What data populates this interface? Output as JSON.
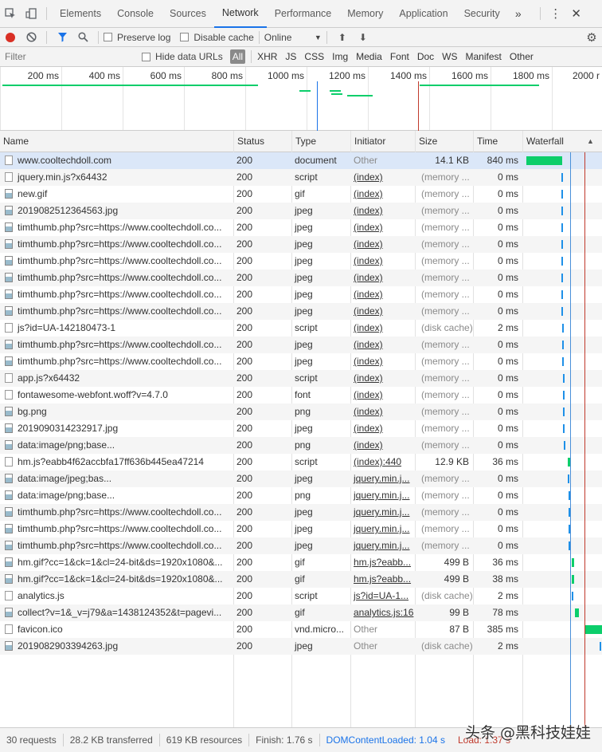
{
  "tabs": [
    "Elements",
    "Console",
    "Sources",
    "Network",
    "Performance",
    "Memory",
    "Application",
    "Security"
  ],
  "toolbar": {
    "preserve_log": "Preserve log",
    "disable_cache": "Disable cache",
    "throttle": "Online"
  },
  "filter": {
    "placeholder": "Filter",
    "hide_data_urls": "Hide data URLs",
    "types": [
      "All",
      "XHR",
      "JS",
      "CSS",
      "Img",
      "Media",
      "Font",
      "Doc",
      "WS",
      "Manifest",
      "Other"
    ]
  },
  "overview": {
    "ticks": [
      "200 ms",
      "400 ms",
      "600 ms",
      "800 ms",
      "1000 ms",
      "1200 ms",
      "1400 ms",
      "1600 ms",
      "1800 ms",
      "2000 r"
    ]
  },
  "columns": [
    "Name",
    "Status",
    "Type",
    "Initiator",
    "Size",
    "Time",
    "Waterfall"
  ],
  "rows": [
    {
      "name": "www.cooltechdoll.com",
      "status": "200",
      "type": "document",
      "initiator": "Other",
      "size": "14.1 KB",
      "time": "840 ms"
    },
    {
      "name": "jquery.min.js?x64432",
      "status": "200",
      "type": "script",
      "initiator": "(index)",
      "size": "(memory ...",
      "time": "0 ms"
    },
    {
      "name": "new.gif",
      "status": "200",
      "type": "gif",
      "initiator": "(index)",
      "size": "(memory ...",
      "time": "0 ms"
    },
    {
      "name": "2019082512364563.jpg",
      "status": "200",
      "type": "jpeg",
      "initiator": "(index)",
      "size": "(memory ...",
      "time": "0 ms"
    },
    {
      "name": "timthumb.php?src=https://www.cooltechdoll.co...",
      "status": "200",
      "type": "jpeg",
      "initiator": "(index)",
      "size": "(memory ...",
      "time": "0 ms"
    },
    {
      "name": "timthumb.php?src=https://www.cooltechdoll.co...",
      "status": "200",
      "type": "jpeg",
      "initiator": "(index)",
      "size": "(memory ...",
      "time": "0 ms"
    },
    {
      "name": "timthumb.php?src=https://www.cooltechdoll.co...",
      "status": "200",
      "type": "jpeg",
      "initiator": "(index)",
      "size": "(memory ...",
      "time": "0 ms"
    },
    {
      "name": "timthumb.php?src=https://www.cooltechdoll.co...",
      "status": "200",
      "type": "jpeg",
      "initiator": "(index)",
      "size": "(memory ...",
      "time": "0 ms"
    },
    {
      "name": "timthumb.php?src=https://www.cooltechdoll.co...",
      "status": "200",
      "type": "jpeg",
      "initiator": "(index)",
      "size": "(memory ...",
      "time": "0 ms"
    },
    {
      "name": "timthumb.php?src=https://www.cooltechdoll.co...",
      "status": "200",
      "type": "jpeg",
      "initiator": "(index)",
      "size": "(memory ...",
      "time": "0 ms"
    },
    {
      "name": "js?id=UA-142180473-1",
      "status": "200",
      "type": "script",
      "initiator": "(index)",
      "size": "(disk cache)",
      "time": "2 ms"
    },
    {
      "name": "timthumb.php?src=https://www.cooltechdoll.co...",
      "status": "200",
      "type": "jpeg",
      "initiator": "(index)",
      "size": "(memory ...",
      "time": "0 ms"
    },
    {
      "name": "timthumb.php?src=https://www.cooltechdoll.co...",
      "status": "200",
      "type": "jpeg",
      "initiator": "(index)",
      "size": "(memory ...",
      "time": "0 ms"
    },
    {
      "name": "app.js?x64432",
      "status": "200",
      "type": "script",
      "initiator": "(index)",
      "size": "(memory ...",
      "time": "0 ms"
    },
    {
      "name": "fontawesome-webfont.woff?v=4.7.0",
      "status": "200",
      "type": "font",
      "initiator": "(index)",
      "size": "(memory ...",
      "time": "0 ms"
    },
    {
      "name": "bg.png",
      "status": "200",
      "type": "png",
      "initiator": "(index)",
      "size": "(memory ...",
      "time": "0 ms"
    },
    {
      "name": "2019090314232917.jpg",
      "status": "200",
      "type": "jpeg",
      "initiator": "(index)",
      "size": "(memory ...",
      "time": "0 ms"
    },
    {
      "name": "data:image/png;base...",
      "status": "200",
      "type": "png",
      "initiator": "(index)",
      "size": "(memory ...",
      "time": "0 ms"
    },
    {
      "name": "hm.js?eabb4f62accbfa17ff636b445ea47214",
      "status": "200",
      "type": "script",
      "initiator": "(index):440",
      "size": "12.9 KB",
      "time": "36 ms"
    },
    {
      "name": "data:image/jpeg;bas...",
      "status": "200",
      "type": "jpeg",
      "initiator": "jquery.min.j...",
      "size": "(memory ...",
      "time": "0 ms"
    },
    {
      "name": "data:image/png;base...",
      "status": "200",
      "type": "png",
      "initiator": "jquery.min.j...",
      "size": "(memory ...",
      "time": "0 ms"
    },
    {
      "name": "timthumb.php?src=https://www.cooltechdoll.co...",
      "status": "200",
      "type": "jpeg",
      "initiator": "jquery.min.j...",
      "size": "(memory ...",
      "time": "0 ms"
    },
    {
      "name": "timthumb.php?src=https://www.cooltechdoll.co...",
      "status": "200",
      "type": "jpeg",
      "initiator": "jquery.min.j...",
      "size": "(memory ...",
      "time": "0 ms"
    },
    {
      "name": "timthumb.php?src=https://www.cooltechdoll.co...",
      "status": "200",
      "type": "jpeg",
      "initiator": "jquery.min.j...",
      "size": "(memory ...",
      "time": "0 ms"
    },
    {
      "name": "hm.gif?cc=1&ck=1&cl=24-bit&ds=1920x1080&...",
      "status": "200",
      "type": "gif",
      "initiator": "hm.js?eabb...",
      "size": "499 B",
      "time": "36 ms"
    },
    {
      "name": "hm.gif?cc=1&ck=1&cl=24-bit&ds=1920x1080&...",
      "status": "200",
      "type": "gif",
      "initiator": "hm.js?eabb...",
      "size": "499 B",
      "time": "38 ms"
    },
    {
      "name": "analytics.js",
      "status": "200",
      "type": "script",
      "initiator": "js?id=UA-1...",
      "size": "(disk cache)",
      "time": "2 ms"
    },
    {
      "name": "collect?v=1&_v=j79&a=1438124352&t=pagevi...",
      "status": "200",
      "type": "gif",
      "initiator": "analytics.js:16",
      "size": "99 B",
      "time": "78 ms"
    },
    {
      "name": "favicon.ico",
      "status": "200",
      "type": "vnd.micro...",
      "initiator": "Other",
      "size": "87 B",
      "time": "385 ms"
    },
    {
      "name": "2019082903394263.jpg",
      "status": "200",
      "type": "jpeg",
      "initiator": "Other",
      "size": "(disk cache)",
      "time": "2 ms"
    }
  ],
  "status": {
    "requests": "30 requests",
    "transferred": "28.2 KB transferred",
    "resources": "619 KB resources",
    "finish": "Finish: 1.76 s",
    "dcl": "DOMContentLoaded: 1.04 s",
    "load": "Load: 1.37 s"
  },
  "watermark": "头条 @黑科技娃娃",
  "colors": {
    "accent": "#1a73e8",
    "record": "#d93025",
    "dcl_line": "#1a73e8",
    "load_line": "#c0392b",
    "waterfall_green": "#0cce6b",
    "waterfall_blue": "#1e90e8"
  }
}
